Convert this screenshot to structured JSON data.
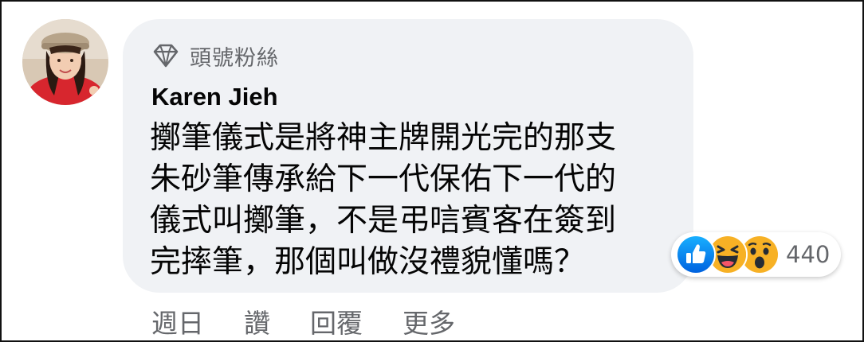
{
  "comment": {
    "badge_label": "頭號粉絲",
    "author": "Karen Jieh",
    "text_lines": [
      "擲筆儀式是將神主牌開光完的那支",
      "朱砂筆傳承給下一代保佑下一代的",
      "儀式叫擲筆，不是弔唁賓客在簽到",
      "完摔筆，那個叫做沒禮貌懂嗎？"
    ],
    "reactions": {
      "icons": [
        "like-icon",
        "haha-icon",
        "wow-icon"
      ],
      "count": "440"
    },
    "actions": {
      "time": "週日",
      "like": "讚",
      "reply": "回覆",
      "more": "更多"
    }
  },
  "colors": {
    "bubble": "#f0f2f5",
    "secondary_text": "#65676b",
    "like_blue": "#1877f2",
    "emoji_yellow": "#f7b125"
  }
}
